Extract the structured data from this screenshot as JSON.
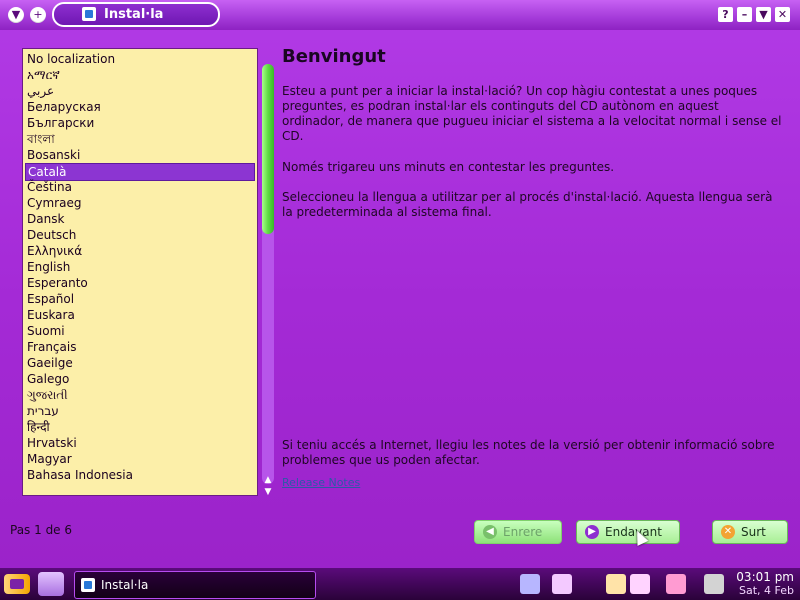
{
  "window": {
    "title": "Instal·la",
    "controls": [
      "?",
      "–",
      "▼",
      "✕"
    ]
  },
  "languages": {
    "items": [
      "No localization",
      "አማርኛ",
      "عربي",
      "Беларуская",
      "Български",
      "বাংলা",
      "Bosanski",
      "Català",
      "Čeština",
      "Cymraeg",
      "Dansk",
      "Deutsch",
      "Ελληνικά",
      "English",
      "Esperanto",
      "Español",
      "Euskara",
      "Suomi",
      "Français",
      "Gaeilge",
      "Galego",
      "ગુજરાતી",
      "עברית",
      "हिन्दी",
      "Hrvatski",
      "Magyar",
      "Bahasa Indonesia"
    ],
    "selected_index": 7
  },
  "content": {
    "title": "Benvingut",
    "para1": "Esteu a punt per a iniciar la instal·lació? Un cop hàgiu contestat a unes poques preguntes, es podran instal·lar els continguts del CD autònom en aquest ordinador, de manera que pugueu iniciar el sistema a la velocitat normal i sense el CD.",
    "para2": "Només trigareu uns minuts en contestar les preguntes.",
    "para3": "Seleccioneu la llengua a utilitzar per al procés d'instal·lació. Aquesta llengua serà la predeterminada al sistema final.",
    "para4": "Si teniu accés a Internet, llegiu les notes de la versió per obtenir informació sobre problemes que us poden afectar.",
    "release_notes": "Release Notes"
  },
  "footer": {
    "page_count": "Pas 1 de 6",
    "back": "Enrere",
    "forward": "Endavant",
    "quit": "Surt"
  },
  "taskbar": {
    "task_label": "Instal·la",
    "time": "03:01 pm",
    "date": "Sat, 4 Feb"
  },
  "colors": {
    "window_bg": "#a42ad6",
    "list_bg": "#fcefa9",
    "selection": "#8c35d2",
    "button_green": "#a9ef95"
  }
}
